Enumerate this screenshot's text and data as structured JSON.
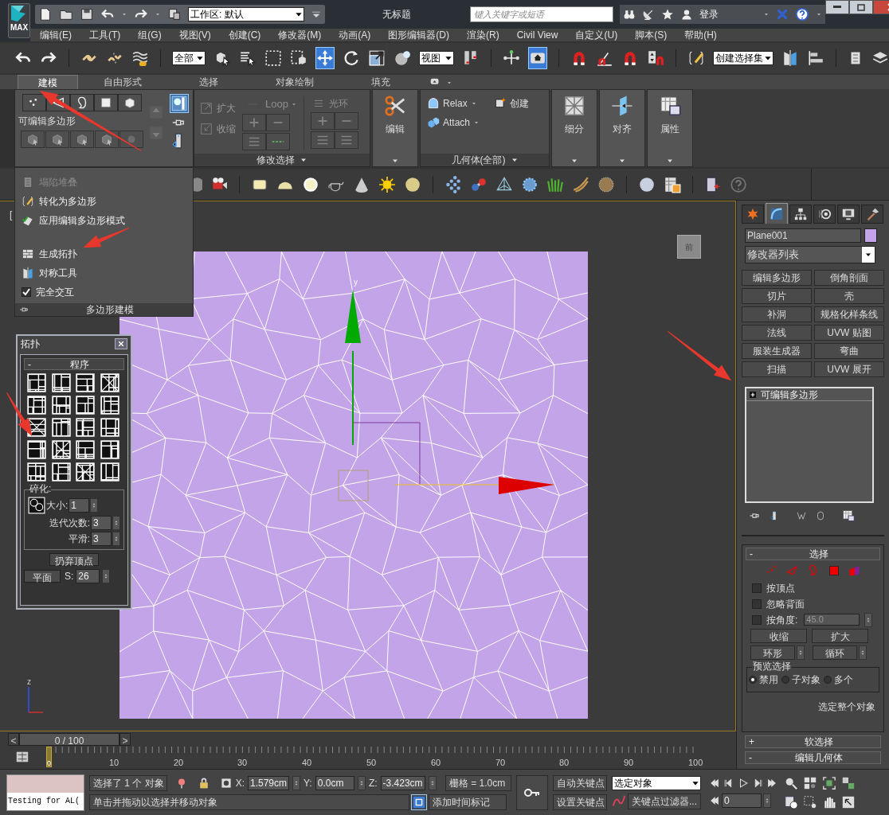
{
  "window": {
    "logo": "MAX",
    "workspace": "工作区: 默认",
    "title": "无标题",
    "search_placeholder": "键入关键字或短语",
    "login": "登录"
  },
  "menu": [
    "编辑(E)",
    "工具(T)",
    "组(G)",
    "视图(V)",
    "创建(C)",
    "修改器(M)",
    "动画(A)",
    "图形编辑器(D)",
    "渲染(R)",
    "Civil View",
    "自定义(U)",
    "脚本(S)",
    "帮助(H)"
  ],
  "toolbar": {
    "selection_filter": "全部",
    "reference_coordinates": "视图",
    "named_selection": "创建选择集"
  },
  "ribbon": {
    "tabs": [
      {
        "label": "建模",
        "selected": true
      },
      {
        "label": "自由形式",
        "selected": false
      },
      {
        "label": "选择",
        "selected": false
      },
      {
        "label": "对象绘制",
        "selected": false
      },
      {
        "label": "填充",
        "selected": false
      }
    ],
    "polygon_modeling": {
      "title": "可编辑多边形",
      "footer": "多边形建模",
      "menu": [
        {
          "label": "塌陷堆叠",
          "disabled": true
        },
        {
          "label": "转化为多边形",
          "disabled": false
        },
        {
          "label": "应用编辑多边形模式",
          "disabled": false
        },
        {
          "label": "生成拓扑",
          "disabled": false
        },
        {
          "label": "对称工具",
          "disabled": false
        }
      ],
      "full_interaction": {
        "label": "完全交互",
        "checked": true
      }
    },
    "modify_selection": {
      "grow": "扩大",
      "shrink": "收缩",
      "loop": "Loop",
      "ring": "光环",
      "footer": "修改选择"
    },
    "edit": "编辑",
    "geometry": {
      "relax": "Relax",
      "create": "创建",
      "attach": "Attach",
      "footer": "几何体(全部)"
    },
    "big_buttons": [
      "细分",
      "对齐",
      "属性"
    ]
  },
  "viewport": {
    "label": "[",
    "viewcube": "前",
    "gizmo_axis": "y",
    "tripod_axis": "z"
  },
  "topology": {
    "title": "拓扑",
    "procedures": {
      "toggle": "-",
      "title": "程序"
    },
    "shatter": {
      "title": "碎化:",
      "size_label": "大小:",
      "size": "1",
      "iterations_label": "迭代次数:",
      "iterations": "3",
      "smooth_label": "平滑:",
      "smooth": "3"
    },
    "discard": "扔弃顶点",
    "plane": "平面",
    "s_label": "S:",
    "s_value": "26"
  },
  "command_panel": {
    "tabs": [
      {
        "selected": false
      },
      {
        "selected": true
      },
      {
        "selected": false
      },
      {
        "selected": false
      },
      {
        "selected": false
      },
      {
        "selected": false
      }
    ],
    "object_name": "Plane001",
    "modifier_list": "修改器列表",
    "modifiers": [
      "编辑多边形",
      "倒角剖面",
      "切片",
      "壳",
      "补洞",
      "规格化样条线",
      "法线",
      "UVW 贴图",
      "服装生成器",
      "弯曲",
      "扫描",
      "UVW 展开"
    ],
    "stack": [
      {
        "label": "可编辑多边形"
      }
    ],
    "selection": {
      "toggle": "-",
      "title": "选择",
      "options": [
        {
          "label": "按顶点",
          "checked": false
        },
        {
          "label": "忽略背面",
          "checked": false
        },
        {
          "label": "按角度:",
          "checked": false
        }
      ],
      "angle": "45.0",
      "shrink": "收缩",
      "grow": "扩大",
      "ring": "环形",
      "loop": "循环",
      "preview": {
        "title": "预览选择",
        "options": [
          {
            "label": "禁用",
            "selected": true
          },
          {
            "label": "子对象",
            "selected": false
          },
          {
            "label": "多个",
            "selected": false
          }
        ]
      },
      "select_whole": "选定整个对象"
    },
    "rollouts": [
      {
        "toggle": "+",
        "title": "软选择"
      },
      {
        "toggle": "-",
        "title": "编辑几何体"
      }
    ]
  },
  "timeline": {
    "prev": "<",
    "position": "0 / 100",
    "next": ">",
    "current": "0",
    "ticks": [
      "10",
      "20",
      "30",
      "40",
      "50",
      "60",
      "70",
      "80",
      "90",
      "100"
    ]
  },
  "status": {
    "listener_input": "Testing for AL(",
    "selection": "选择了 1 个 对象",
    "x_label": "X:",
    "x": "1.579cm",
    "y_label": "Y:",
    "y": "0.0cm",
    "z_label": "Z:",
    "z": "-3.423cm",
    "grid": "栅格 = 1.0cm",
    "prompt": "单击并拖动以选择并移动对象",
    "add_time_tag": "添加时间标记",
    "auto_key": "自动关键点",
    "set_key": "设置关键点",
    "key_target": "选定对象",
    "key_filters": "关键点过滤器...",
    "frame": "0"
  }
}
